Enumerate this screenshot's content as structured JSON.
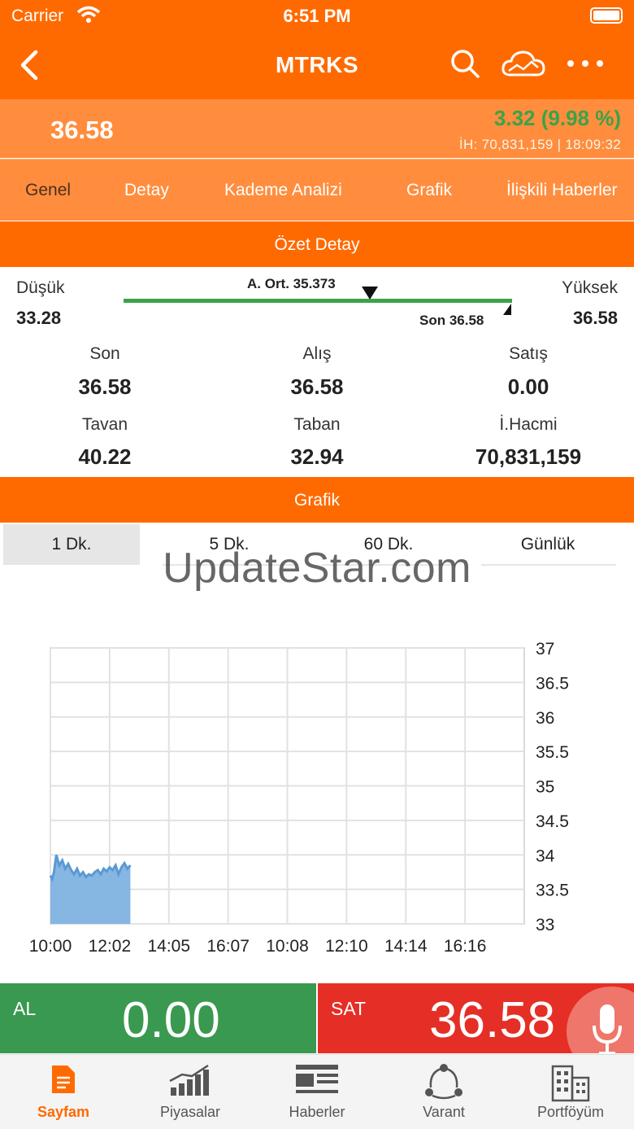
{
  "status_bar": {
    "carrier": "Carrier",
    "time": "6:51 PM"
  },
  "nav": {
    "title": "MTRKS"
  },
  "quote": {
    "price": "36.58",
    "change": "3.32 (9.98 %)",
    "volume_line": "İH:  70,831,159 | 18:09:32"
  },
  "tabs": [
    "Genel",
    "Detay",
    "Kademe Analizi",
    "Grafik",
    "İlişkili Haberler"
  ],
  "summary": {
    "header": "Özet Detay",
    "low_label": "Düşük",
    "low_value": "33.28",
    "high_label": "Yüksek",
    "high_value": "36.58",
    "avg_label": "A. Ort. 35.373",
    "last_marker": "Son 36.58",
    "stats": [
      {
        "label": "Son",
        "value": "36.58"
      },
      {
        "label": "Alış",
        "value": "36.58"
      },
      {
        "label": "Satış",
        "value": "0.00"
      },
      {
        "label": "Tavan",
        "value": "40.22"
      },
      {
        "label": "Taban",
        "value": "32.94"
      },
      {
        "label": "İ.Hacmi",
        "value": "70,831,159"
      }
    ]
  },
  "graph": {
    "header": "Grafik",
    "periods": [
      "1 Dk.",
      "5 Dk.",
      "60 Dk.",
      "Günlük"
    ],
    "selected_period": "1 Dk.",
    "watermark": "UpdateStar.com"
  },
  "chart_data": {
    "type": "area",
    "title": "",
    "xlabel": "",
    "ylabel": "",
    "x_ticks": [
      "10:00",
      "12:02",
      "14:05",
      "16:07",
      "10:08",
      "12:10",
      "14:14",
      "16:16"
    ],
    "y_ticks": [
      37,
      36.5,
      36,
      35.5,
      35,
      34.5,
      34,
      33.5,
      33
    ],
    "ylim": [
      33,
      37
    ],
    "grid": true,
    "series": [
      {
        "color": "#7fb2e0",
        "x": [
          0,
          0.03,
          0.06,
          0.1,
          0.15,
          0.2,
          0.25,
          0.3,
          0.35,
          0.4,
          0.45,
          0.5,
          0.55,
          0.6,
          0.65,
          0.7,
          0.75,
          0.8,
          0.85,
          0.9,
          0.95,
          1.0,
          1.05,
          1.1,
          1.15,
          1.2,
          1.25,
          1.3,
          1.35
        ],
        "values": [
          33.7,
          33.65,
          33.75,
          34.0,
          33.85,
          33.92,
          33.8,
          33.87,
          33.78,
          33.72,
          33.8,
          33.7,
          33.75,
          33.68,
          33.72,
          33.7,
          33.75,
          33.78,
          33.72,
          33.8,
          33.76,
          33.82,
          33.78,
          33.85,
          33.72,
          33.82,
          33.88,
          33.8,
          33.85
        ]
      }
    ]
  },
  "trade": {
    "buy_label": "AL",
    "buy_value": "0.00",
    "sell_label": "SAT",
    "sell_value": "36.58",
    "accent_buy": "#3a9950",
    "accent_sell": "#e52e25"
  },
  "tabbar": {
    "items": [
      {
        "label": "Sayfam",
        "icon": "document-icon",
        "active": true
      },
      {
        "label": "Piyasalar",
        "icon": "bar-chart-icon",
        "active": false
      },
      {
        "label": "Haberler",
        "icon": "newspaper-icon",
        "active": false
      },
      {
        "label": "Varant",
        "icon": "network-icon",
        "active": false
      },
      {
        "label": "Portföyüm",
        "icon": "buildings-icon",
        "active": false
      }
    ]
  },
  "colors": {
    "brand": "#ff6a00",
    "brand_light": "#ff8d3d",
    "positive": "#3aa349"
  }
}
